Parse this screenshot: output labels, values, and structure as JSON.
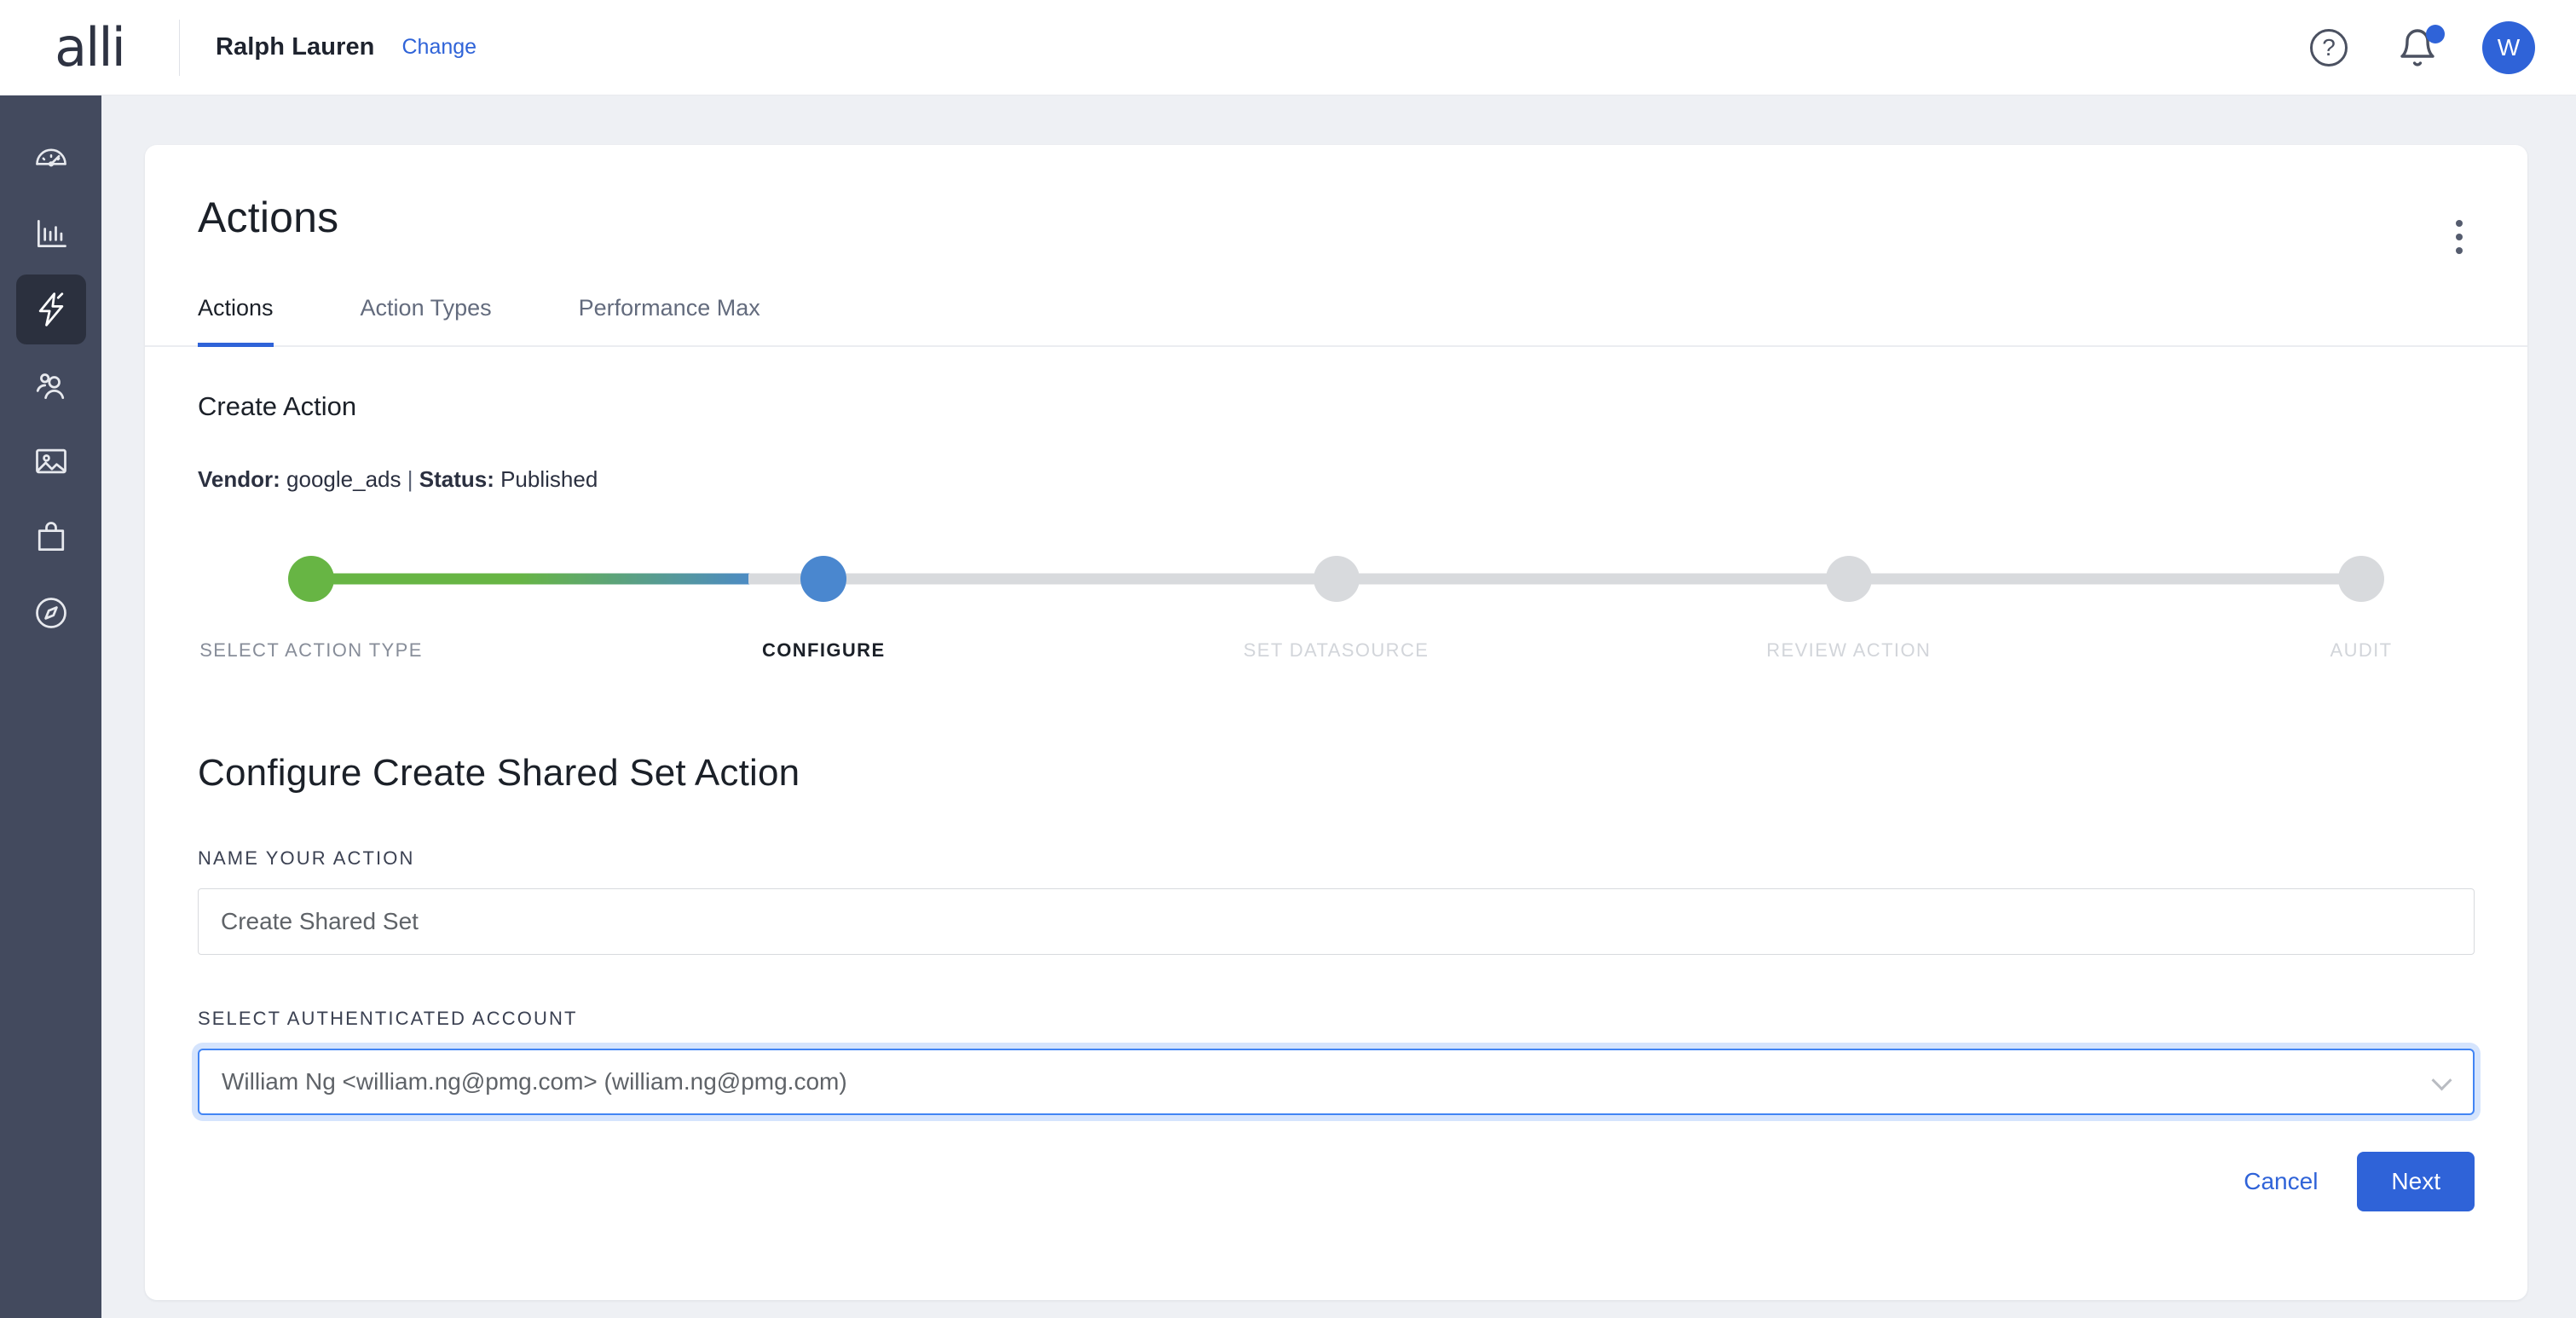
{
  "topbar": {
    "logo": "alli",
    "brand_name": "Ralph Lauren",
    "change_label": "Change",
    "help_glyph": "?",
    "avatar_initial": "W"
  },
  "sidebar": {
    "items": [
      {
        "icon": "gauge-icon",
        "active": false
      },
      {
        "icon": "bar-chart-icon",
        "active": false
      },
      {
        "icon": "lightning-bolt-icon",
        "active": true
      },
      {
        "icon": "audience-icon",
        "active": false
      },
      {
        "icon": "image-icon",
        "active": false
      },
      {
        "icon": "shopping-bag-icon",
        "active": false
      },
      {
        "icon": "compass-icon",
        "active": false
      }
    ]
  },
  "card": {
    "page_title": "Actions",
    "tabs": [
      {
        "label": "Actions",
        "active": true
      },
      {
        "label": "Action Types",
        "active": false
      },
      {
        "label": "Performance Max",
        "active": false
      }
    ],
    "section_heading": "Create Action",
    "meta": {
      "vendor_label": "Vendor:",
      "vendor_value": "google_ads",
      "separator": "|",
      "status_label": "Status:",
      "status_value": "Published"
    },
    "stepper": {
      "steps": [
        {
          "label": "SELECT ACTION TYPE",
          "state": "done"
        },
        {
          "label": "CONFIGURE",
          "state": "current"
        },
        {
          "label": "SET DATASOURCE",
          "state": "todo"
        },
        {
          "label": "REVIEW ACTION",
          "state": "todo"
        },
        {
          "label": "AUDIT",
          "state": "todo"
        }
      ],
      "done_color": "#67b544",
      "current_color": "#4a87cf",
      "todo_color": "#d8dadd"
    },
    "form": {
      "heading": "Configure Create Shared Set Action",
      "name_label": "NAME YOUR ACTION",
      "name_value": "Create Shared Set",
      "name_placeholder": "Create Shared Set",
      "account_label": "SELECT AUTHENTICATED ACCOUNT",
      "account_value": "William Ng <william.ng@pmg.com> (william.ng@pmg.com)"
    },
    "actions": {
      "cancel_label": "Cancel",
      "next_label": "Next"
    }
  },
  "colors": {
    "accent_blue": "#2f63d8",
    "focus_blue": "#4285f4",
    "sidebar_bg": "#434a5e",
    "page_bg": "#eef0f4"
  }
}
